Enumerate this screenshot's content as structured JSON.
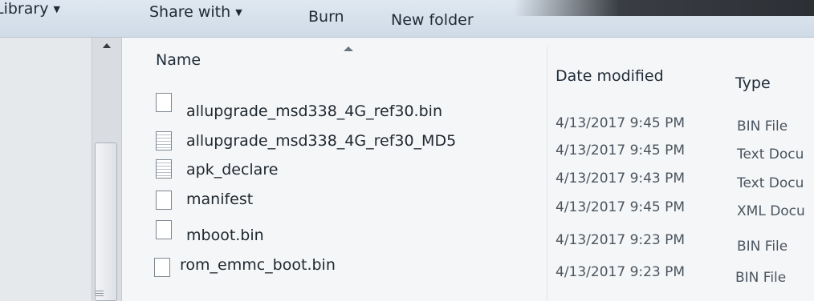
{
  "toolbar": {
    "library_label": "Library",
    "share_label": "Share with",
    "burn_label": "Burn",
    "new_folder_label": "New folder"
  },
  "columns": {
    "name": "Name",
    "date_modified": "Date modified",
    "type": "Type"
  },
  "files": [
    {
      "name": "allupgrade_msd338_4G_ref30.bin",
      "date": "4/13/2017 9:45 PM",
      "type": "BIN File",
      "icon": "file-icon"
    },
    {
      "name": "allupgrade_msd338_4G_ref30_MD5",
      "date": "4/13/2017 9:45 PM",
      "type": "Text Docu",
      "icon": "text-document-icon"
    },
    {
      "name": "apk_declare",
      "date": "4/13/2017 9:43 PM",
      "type": "Text Docu",
      "icon": "text-document-icon"
    },
    {
      "name": "manifest",
      "date": "4/13/2017 9:45 PM",
      "type": "XML Docu",
      "icon": "file-icon"
    },
    {
      "name": "mboot.bin",
      "date": "4/13/2017 9:23 PM",
      "type": "BIN File",
      "icon": "file-icon"
    },
    {
      "name": "rom_emmc_boot.bin",
      "date": "4/13/2017 9:23 PM",
      "type": "BIN File",
      "icon": "file-icon"
    }
  ]
}
